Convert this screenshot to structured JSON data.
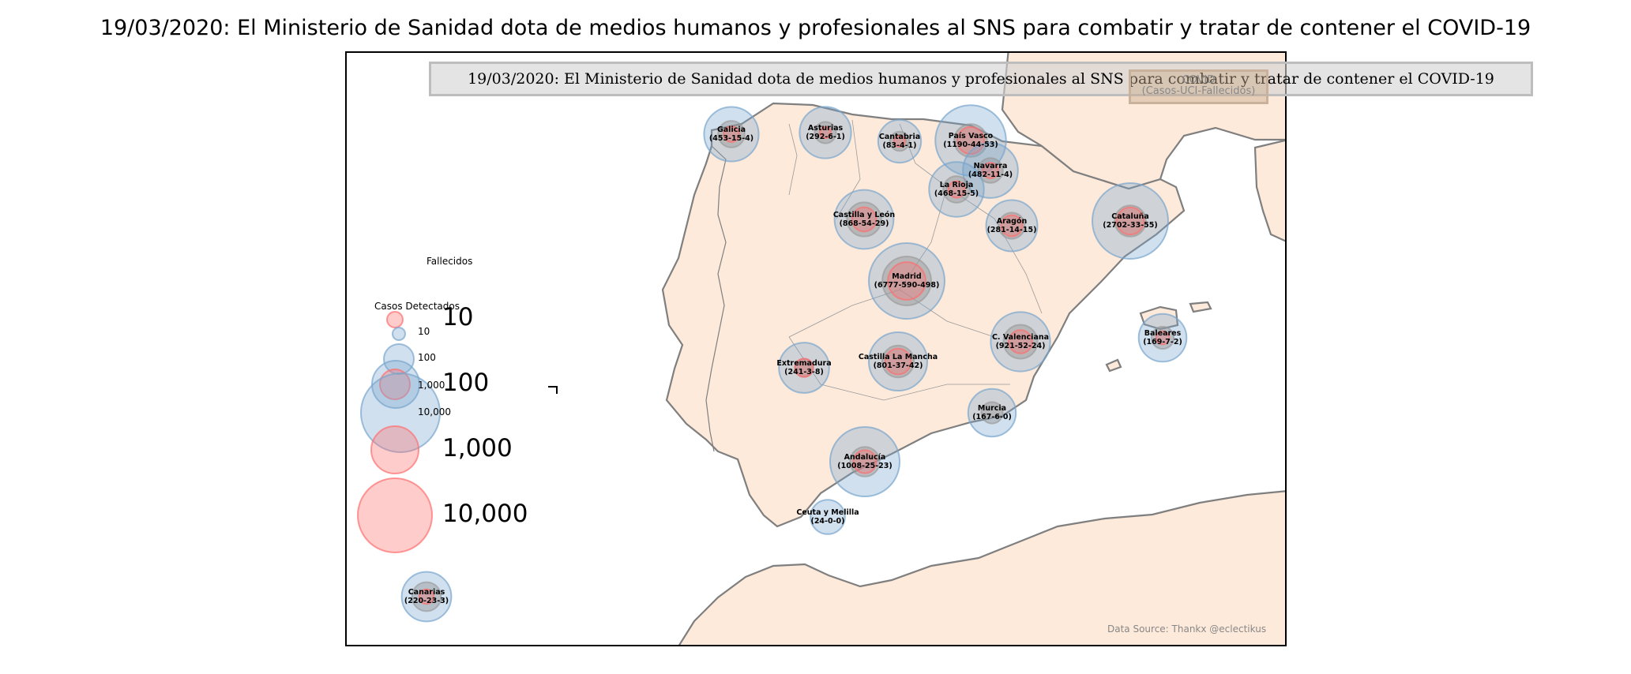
{
  "title": "19/03/2020: El Ministerio de Sanidad dota de medios humanos y profesionales al SNS para combatir y tratar de contener el COVID-19",
  "annotation": "19/03/2020: El Ministerio de Sanidad dota de medios humanos y profesionales al SNS para combatir y tratar de contener el COVID-19",
  "mini_legend": {
    "line1": "COVID",
    "line2": "(Casos-UCI-Fallecidos)"
  },
  "legend": {
    "deaths_title": "Fallecidos",
    "cases_title": "Casos Detectados",
    "cases_sizes": [
      "10",
      "100",
      "1,000",
      "10,000"
    ],
    "deaths_sizes": [
      "10",
      "100",
      "1,000",
      "10,000"
    ]
  },
  "source": "Data Source: Thankx @eclectikus",
  "colors": {
    "land": "#fdeadb",
    "coast": "#7f7f7f",
    "cases_fill": "rgba(120,165,205,0.35)",
    "deaths_fill": "rgba(255,110,110,0.35)",
    "icu_fill": "rgba(150,150,150,0.45)"
  },
  "regions": [
    {
      "name": "Galicia",
      "stats": "(453-15-4)",
      "cases": 453,
      "icu": 15,
      "deaths": 4
    },
    {
      "name": "Asturias",
      "stats": "(292-6-1)",
      "cases": 292,
      "icu": 6,
      "deaths": 1
    },
    {
      "name": "Cantabria",
      "stats": "(83-4-1)",
      "cases": 83,
      "icu": 4,
      "deaths": 1
    },
    {
      "name": "País Vasco",
      "stats": "(1190-44-53)",
      "cases": 1190,
      "icu": 44,
      "deaths": 53
    },
    {
      "name": "Navarra",
      "stats": "(482-11-4)",
      "cases": 482,
      "icu": 11,
      "deaths": 4
    },
    {
      "name": "La Rioja",
      "stats": "(468-15-5)",
      "cases": 468,
      "icu": 15,
      "deaths": 5
    },
    {
      "name": "Castilla y León",
      "stats": "(868-54-29)",
      "cases": 868,
      "icu": 54,
      "deaths": 29
    },
    {
      "name": "Aragón",
      "stats": "(281-14-15)",
      "cases": 281,
      "icu": 14,
      "deaths": 15
    },
    {
      "name": "Cataluña",
      "stats": "(2702-33-55)",
      "cases": 2702,
      "icu": 33,
      "deaths": 55
    },
    {
      "name": "Madrid",
      "stats": "(6777-590-498)",
      "cases": 6777,
      "icu": 590,
      "deaths": 498
    },
    {
      "name": "C. Valenciana",
      "stats": "(921-52-24)",
      "cases": 921,
      "icu": 52,
      "deaths": 24
    },
    {
      "name": "Baleares",
      "stats": "(169-7-2)",
      "cases": 169,
      "icu": 7,
      "deaths": 2
    },
    {
      "name": "Extremadura",
      "stats": "(241-3-8)",
      "cases": 241,
      "icu": 3,
      "deaths": 8
    },
    {
      "name": "Castilla La Mancha",
      "stats": "(801-37-42)",
      "cases": 801,
      "icu": 37,
      "deaths": 42
    },
    {
      "name": "Murcia",
      "stats": "(167-6-0)",
      "cases": 167,
      "icu": 6,
      "deaths": 0
    },
    {
      "name": "Andalucía",
      "stats": "(1008-25-23)",
      "cases": 1008,
      "icu": 25,
      "deaths": 23
    },
    {
      "name": "Ceuta y Melilla",
      "stats": "(24-0-0)",
      "cases": 24,
      "icu": 0,
      "deaths": 0
    },
    {
      "name": "Canarias",
      "stats": "(220-23-3)",
      "cases": 220,
      "icu": 23,
      "deaths": 3
    }
  ]
}
